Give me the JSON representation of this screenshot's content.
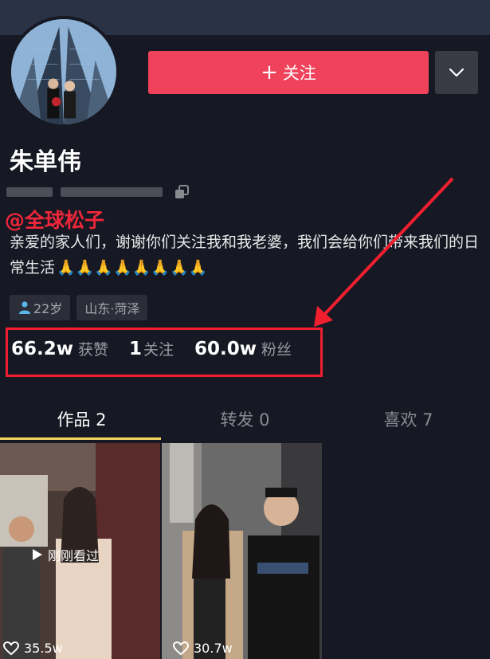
{
  "profile": {
    "name": "朱单伟",
    "watermark": "@全球松子",
    "bio": "亲爱的家人们，谢谢你们关注我和我老婆，我们会给你们带来我们的日常生活",
    "bio_emoji": "🙏🙏🙏🙏🙏🙏🙏🙏",
    "tags": {
      "age": "22岁",
      "location": "山东·菏泽"
    }
  },
  "actions": {
    "follow_label": "关注",
    "follow_plus": "+"
  },
  "stats": [
    {
      "value": "66.2w",
      "label": "获赞"
    },
    {
      "value": "1",
      "label": "关注"
    },
    {
      "value": "60.0w",
      "label": "粉丝"
    }
  ],
  "tabs": [
    {
      "label": "作品 2",
      "active": true
    },
    {
      "label": "转发 0",
      "active": false
    },
    {
      "label": "喜欢 7",
      "active": false
    }
  ],
  "videos": [
    {
      "likes": "35.5w",
      "overlay": "刚刚看过"
    },
    {
      "likes": "30.7w"
    }
  ],
  "colors": {
    "background": "#161823",
    "follow_button": "#f0435b",
    "annotation_red": "#f01f2f",
    "tab_indicator": "#f4d55e"
  },
  "icons": [
    "chevron-down-icon",
    "copy-icon",
    "person-icon",
    "heart-icon",
    "play-icon"
  ]
}
